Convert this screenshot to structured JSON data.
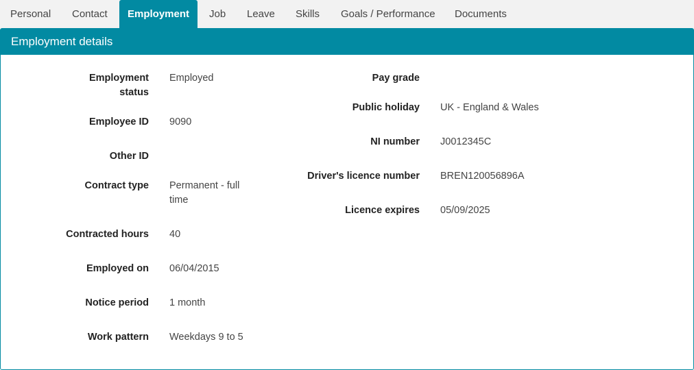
{
  "tabs": [
    {
      "label": "Personal"
    },
    {
      "label": "Contact"
    },
    {
      "label": "Employment"
    },
    {
      "label": "Job"
    },
    {
      "label": "Leave"
    },
    {
      "label": "Skills"
    },
    {
      "label": "Goals / Performance"
    },
    {
      "label": "Documents"
    }
  ],
  "active_tab": "Employment",
  "panel": {
    "title": "Employment details",
    "left": [
      {
        "label": "Employment status",
        "value": "Employed"
      },
      {
        "label": "Employee ID",
        "value": "9090"
      },
      {
        "label": "Other ID",
        "value": ""
      },
      {
        "label": "Contract type",
        "value": "Permanent - full time"
      },
      {
        "label": "Contracted hours",
        "value": "40"
      },
      {
        "label": "Employed on",
        "value": "06/04/2015"
      },
      {
        "label": "Notice period",
        "value": "1 month"
      },
      {
        "label": "Work pattern",
        "value": "Weekdays 9 to 5"
      }
    ],
    "right": [
      {
        "label": "Pay grade",
        "value": ""
      },
      {
        "label": "Public holiday",
        "value": "UK - England & Wales"
      },
      {
        "label": "NI number",
        "value": "J0012345C"
      },
      {
        "label": "Driver's licence number",
        "value": "BREN120056896A"
      },
      {
        "label": "Licence expires",
        "value": "05/09/2025"
      }
    ]
  },
  "colors": {
    "accent": "#028aa2",
    "tabbar_bg": "#f2f2f2"
  }
}
